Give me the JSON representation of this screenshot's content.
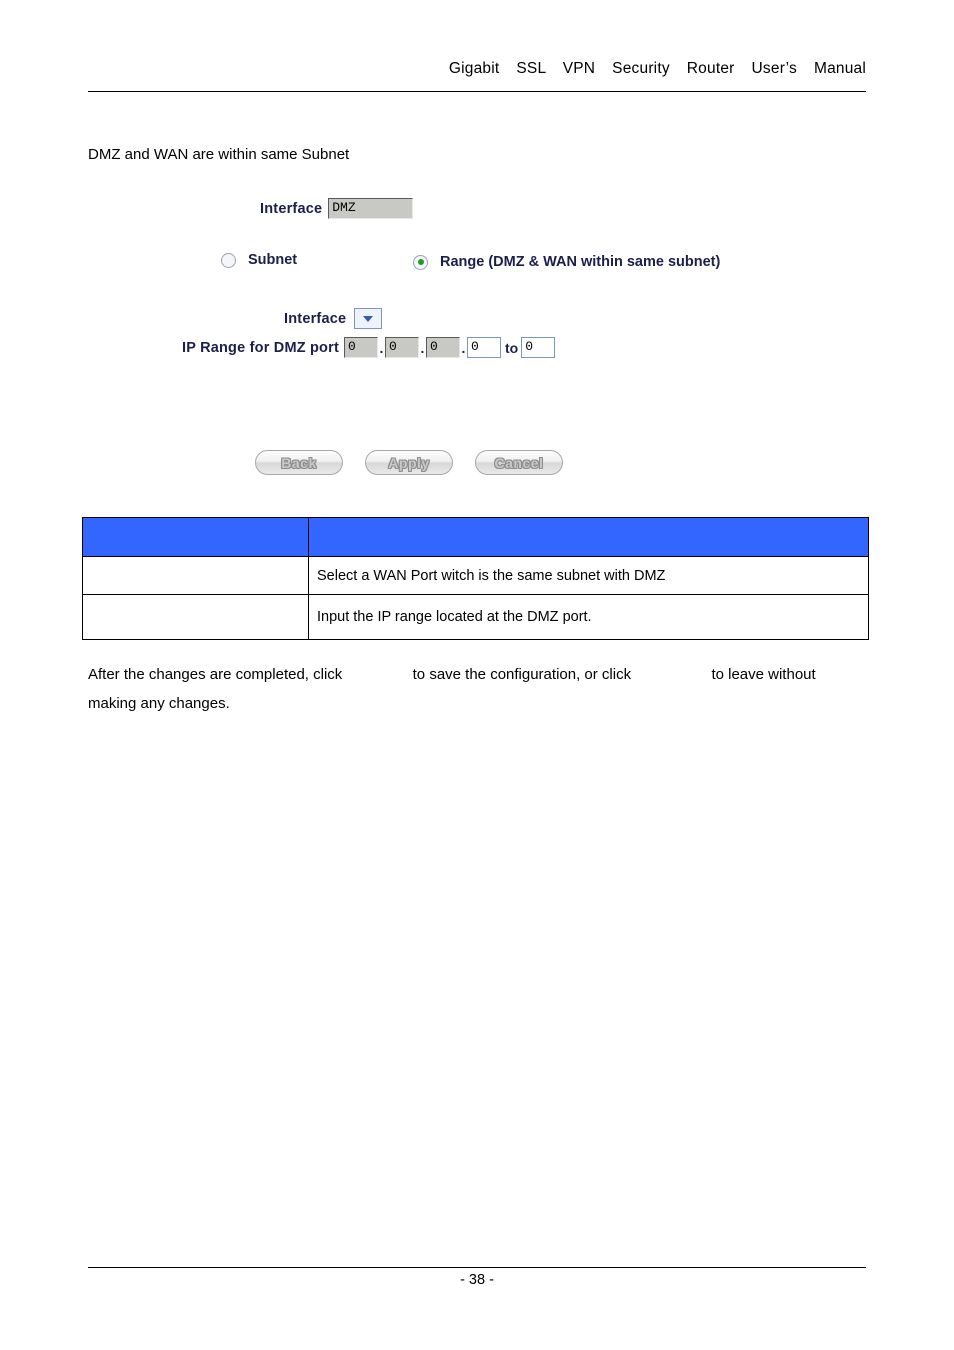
{
  "header": {
    "title": "Gigabit  SSL  VPN  Security  Router  User’s  Manual"
  },
  "intro": {
    "text": "DMZ and WAN are within same Subnet"
  },
  "ui_mock": {
    "interface_top": {
      "label": "Interface",
      "value": "DMZ",
      "state": "disabled"
    },
    "mode_radios": [
      {
        "id": "subnet",
        "label": "Subnet",
        "selected": false
      },
      {
        "id": "range",
        "label": "Range (DMZ & WAN within same subnet)",
        "selected": true
      }
    ],
    "interface_select": {
      "label": "Interface",
      "value": "",
      "icon": "chevron-down-icon"
    },
    "ip_range": {
      "label": "IP Range for DMZ port",
      "separator": ".",
      "to_word": "to",
      "octets": [
        {
          "value": "0",
          "state": "disabled"
        },
        {
          "value": "0",
          "state": "disabled"
        },
        {
          "value": "0",
          "state": "disabled"
        },
        {
          "value": "0",
          "state": "enabled"
        }
      ],
      "end_value": "0"
    },
    "buttons": [
      {
        "id": "back",
        "label": "Back"
      },
      {
        "id": "apply",
        "label": "Apply"
      },
      {
        "id": "cancel",
        "label": "Cancel"
      }
    ]
  },
  "desc_table": {
    "header_color": "#3366ff",
    "headers": [
      "",
      ""
    ],
    "rows": [
      {
        "name": "",
        "description": "Select a WAN Port witch is the same subnet with DMZ"
      },
      {
        "name": "",
        "description": "Input the IP range located at the DMZ port."
      }
    ]
  },
  "trailing_paragraph": {
    "part1": "After the changes are completed, click",
    "part2": "to save the configuration, or click",
    "part3": "to leave without",
    "part4": "making any changes."
  },
  "footer": {
    "page_number": "- 38 -"
  }
}
